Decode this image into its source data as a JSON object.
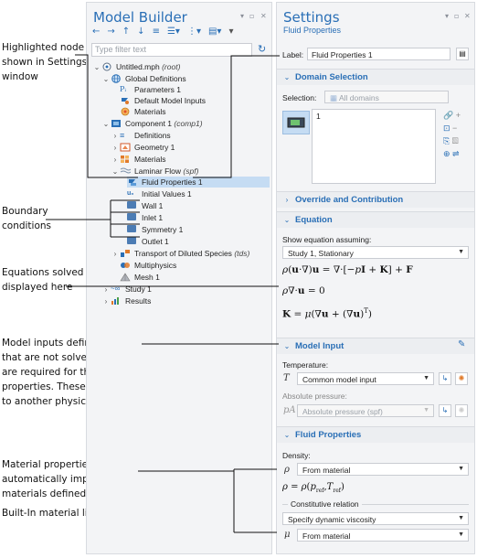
{
  "annotations": {
    "highlighted": [
      "Highlighted node",
      "shown in Settings",
      "window"
    ],
    "boundary": [
      "Boundary",
      "conditions"
    ],
    "equations": [
      "Equations solved are",
      "displayed here"
    ],
    "model_inputs": [
      "Model inputs define quantities",
      "that are not solved for but that",
      "are required for the material",
      "properties. These can be linked",
      "to another physics interface."
    ],
    "material": [
      "Material properties can be",
      "automatically imported from",
      "materials defined in the",
      "Built-In material library."
    ]
  },
  "model_builder": {
    "title": "Model Builder",
    "filter_placeholder": "Type filter text",
    "tree": [
      {
        "label": "Untitled.mph",
        "tag": "(root)",
        "icon": "root-icon"
      },
      {
        "label": "Global Definitions",
        "icon": "globe-icon"
      },
      {
        "label": "Parameters 1",
        "icon": "parameters-icon"
      },
      {
        "label": "Default Model Inputs",
        "icon": "model-inputs-icon"
      },
      {
        "label": "Materials",
        "icon": "materials-icon"
      },
      {
        "label": "Component 1",
        "tag": "(comp1)",
        "icon": "component-icon"
      },
      {
        "label": "Definitions",
        "icon": "definitions-icon"
      },
      {
        "label": "Geometry 1",
        "icon": "geometry-icon"
      },
      {
        "label": "Materials",
        "icon": "materials-icon"
      },
      {
        "label": "Laminar Flow",
        "tag": "(spf)",
        "icon": "laminar-flow-icon"
      },
      {
        "label": "Fluid Properties 1",
        "icon": "fluid-properties-icon"
      },
      {
        "label": "Initial Values 1",
        "icon": "initial-values-icon"
      },
      {
        "label": "Wall 1",
        "icon": "wall-icon"
      },
      {
        "label": "Inlet 1",
        "icon": "inlet-icon"
      },
      {
        "label": "Symmetry 1",
        "icon": "symmetry-icon"
      },
      {
        "label": "Outlet 1",
        "icon": "outlet-icon"
      },
      {
        "label": "Transport of Diluted Species",
        "tag": "(tds)",
        "icon": "transport-icon"
      },
      {
        "label": "Multiphysics",
        "icon": "multiphysics-icon"
      },
      {
        "label": "Mesh 1",
        "icon": "mesh-icon"
      },
      {
        "label": "Study 1",
        "icon": "study-icon"
      },
      {
        "label": "Results",
        "icon": "results-icon"
      }
    ]
  },
  "settings": {
    "title": "Settings",
    "subtitle": "Fluid Properties",
    "label_caption": "Label:",
    "label_value": "Fluid Properties 1",
    "domain_selection": {
      "header": "Domain Selection",
      "selection_caption": "Selection:",
      "selection_value": "All domains",
      "list_item": "1"
    },
    "override_header": "Override and Contribution",
    "equation": {
      "header": "Equation",
      "show_caption": "Show equation assuming:",
      "study_value": "Study 1, Stationary"
    },
    "model_input": {
      "header": "Model Input",
      "temperature_caption": "Temperature:",
      "temperature_symbol": "T",
      "temperature_value": "Common model input",
      "pressure_caption": "Absolute pressure:",
      "pressure_symbol": "pA",
      "pressure_value": "Absolute pressure (spf)"
    },
    "fluid_properties": {
      "header": "Fluid Properties",
      "density_caption": "Density:",
      "density_symbol": "ρ",
      "density_value": "From material",
      "constitutive_caption": "Constitutive relation",
      "constitutive_value": "Specify dynamic viscosity",
      "viscosity_symbol": "μ",
      "viscosity_value": "From material"
    }
  }
}
